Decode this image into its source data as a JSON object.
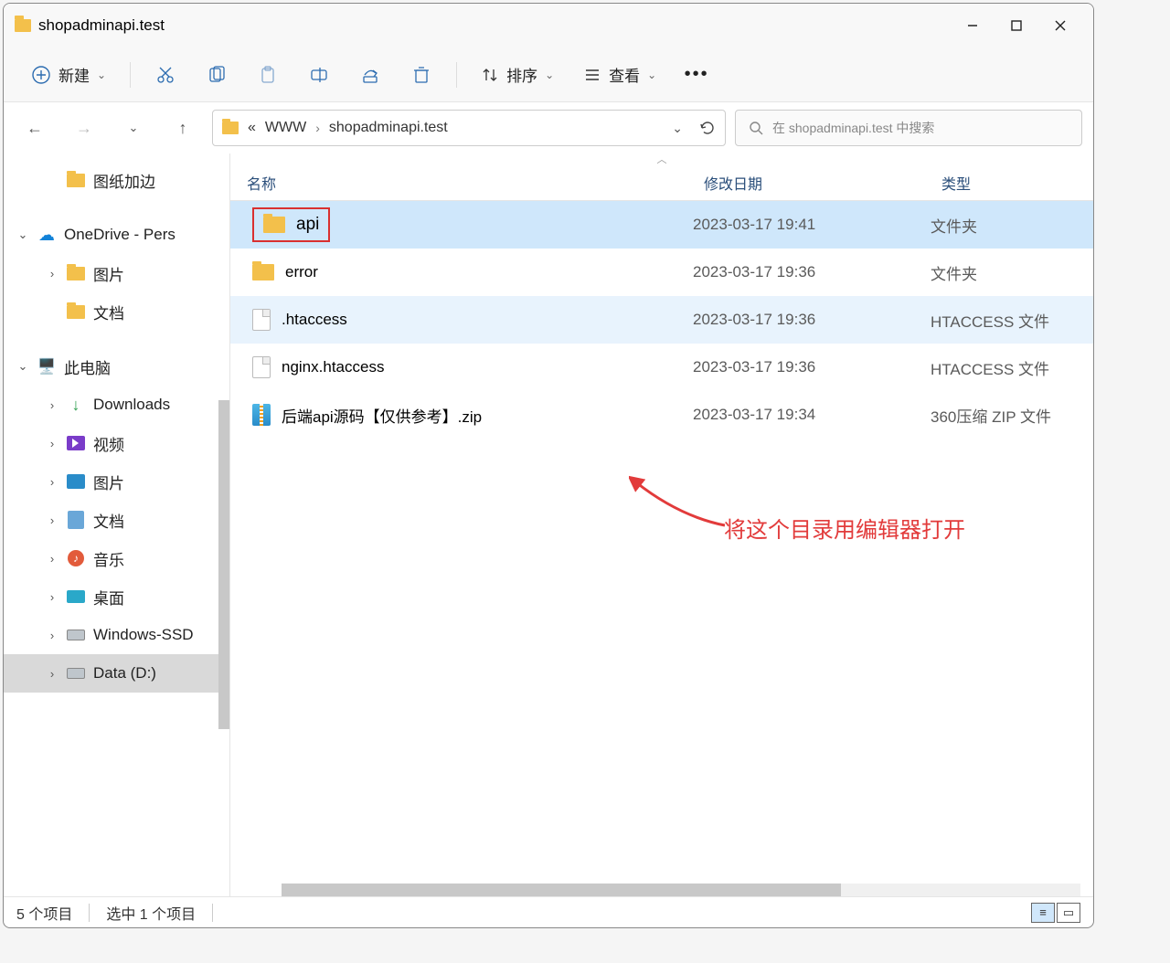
{
  "window": {
    "title": "shopadminapi.test"
  },
  "toolbar": {
    "new_label": "新建",
    "sort_label": "排序",
    "view_label": "查看"
  },
  "breadcrumbs": {
    "ellipsis": "«",
    "seg1": "WWW",
    "seg2": "shopadminapi.test"
  },
  "search": {
    "placeholder": "在 shopadminapi.test 中搜索"
  },
  "columns": {
    "name": "名称",
    "date": "修改日期",
    "type": "类型"
  },
  "sidebar": {
    "items": [
      {
        "label": "图纸加边",
        "icon": "folder",
        "indent": 1
      },
      {
        "label": "OneDrive - Pers",
        "icon": "onedrive",
        "expand": "open",
        "indent": 0
      },
      {
        "label": "图片",
        "icon": "folder",
        "expand": "closed",
        "indent": 1
      },
      {
        "label": "文档",
        "icon": "folder",
        "indent": 1
      },
      {
        "label": "此电脑",
        "icon": "pc",
        "expand": "open",
        "indent": 0
      },
      {
        "label": "Downloads",
        "icon": "download",
        "expand": "closed",
        "indent": 1
      },
      {
        "label": "视频",
        "icon": "video",
        "expand": "closed",
        "indent": 1
      },
      {
        "label": "图片",
        "icon": "pictures",
        "expand": "closed",
        "indent": 1
      },
      {
        "label": "文档",
        "icon": "docs",
        "expand": "closed",
        "indent": 1
      },
      {
        "label": "音乐",
        "icon": "music",
        "expand": "closed",
        "indent": 1
      },
      {
        "label": "桌面",
        "icon": "desktop",
        "expand": "closed",
        "indent": 1
      },
      {
        "label": "Windows-SSD",
        "icon": "disk",
        "expand": "closed",
        "indent": 1
      },
      {
        "label": "Data (D:)",
        "icon": "disk",
        "expand": "closed",
        "indent": 1,
        "selected": true
      }
    ]
  },
  "files": [
    {
      "name": "api",
      "date": "2023-03-17 19:41",
      "type": "文件夹",
      "icon": "folder",
      "state": "selected"
    },
    {
      "name": "error",
      "date": "2023-03-17 19:36",
      "type": "文件夹",
      "icon": "folder"
    },
    {
      "name": ".htaccess",
      "date": "2023-03-17 19:36",
      "type": "HTACCESS 文件",
      "icon": "file",
      "state": "hover"
    },
    {
      "name": "nginx.htaccess",
      "date": "2023-03-17 19:36",
      "type": "HTACCESS 文件",
      "icon": "file"
    },
    {
      "name": "后端api源码【仅供参考】.zip",
      "date": "2023-03-17 19:34",
      "type": "360压缩 ZIP 文件",
      "icon": "zip"
    }
  ],
  "annotation": "将这个目录用编辑器打开",
  "status": {
    "count": "5 个项目",
    "selected": "选中 1 个项目"
  }
}
